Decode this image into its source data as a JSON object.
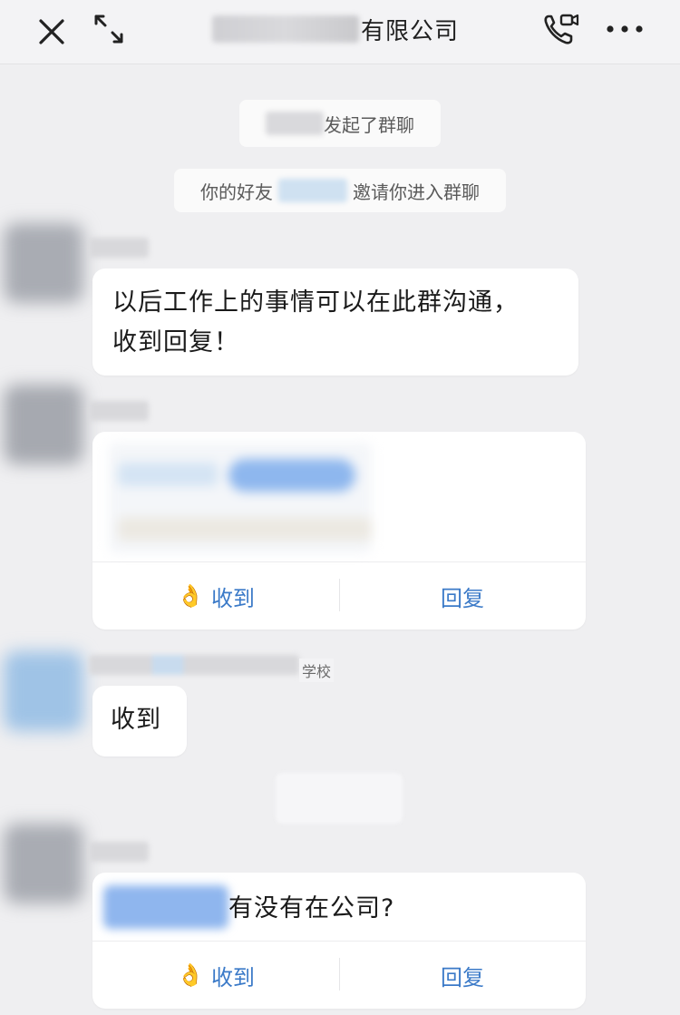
{
  "header": {
    "title_visible": "有限公司",
    "close_icon": "close-icon",
    "expand_icon": "expand-icon",
    "call_icon": "video-call-icon",
    "more_icon": "more-icon"
  },
  "system": {
    "started_group": "发起了群聊",
    "invite_prefix": "你的好友",
    "invite_suffix": "邀请你进入群聊"
  },
  "messages": {
    "m1_text_line1": "以后工作上的事情可以在此群沟通，",
    "m1_text_line2": "收到回复！",
    "m3_tag": "学校",
    "m3_text": "收到",
    "m4_text": "有没有在公司?"
  },
  "card_actions": {
    "receive_label": "收到",
    "reply_label": "回复",
    "hand_emoji": "👌"
  },
  "colors": {
    "accent": "#3b7ac8",
    "background": "#efeff1"
  }
}
